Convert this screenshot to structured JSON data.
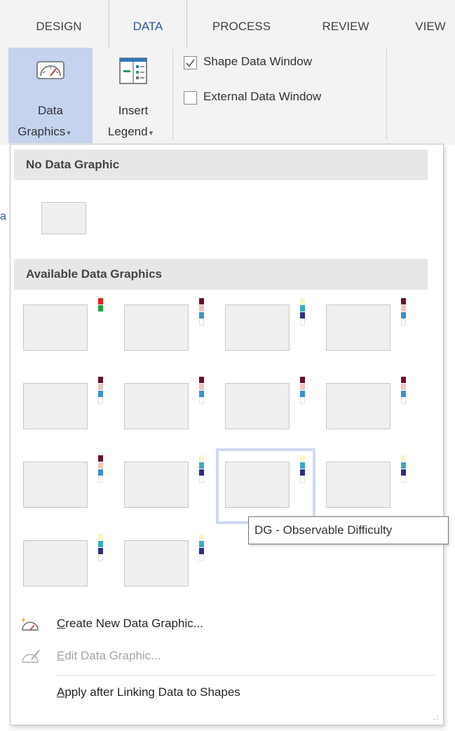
{
  "tabs": [
    {
      "label": "DESIGN"
    },
    {
      "label": "DATA"
    },
    {
      "label": "PROCESS"
    },
    {
      "label": "REVIEW"
    },
    {
      "label": "VIEW"
    }
  ],
  "ribbon": {
    "data_graphics": {
      "line1": "Data",
      "line2": "Graphics"
    },
    "insert_legend": {
      "line1": "Insert",
      "line2": "Legend"
    },
    "shape_data_window": {
      "label": "Shape Data Window",
      "checked": true
    },
    "external_data_window": {
      "label": "External Data Window",
      "checked": false
    }
  },
  "dropdown": {
    "no_data_graphic_header": "No Data Graphic",
    "available_header": "Available Data Graphics",
    "tooltip": "DG - Observable Difficulty",
    "menu": {
      "create_first": "C",
      "create_rest": "reate New Data Graphic...",
      "edit_first": "E",
      "edit_rest": "dit Data Graphic...",
      "apply_first": "A",
      "apply_rest": "pply after Linking Data to Shapes"
    }
  },
  "colors": {
    "accent": "#2b579a",
    "selected_button": "#c5d3ef",
    "highlight_border": "#cdd9f1",
    "dark_red": "#6a0f2a",
    "pink": "#efc6bd",
    "light_blue": "#3c92c8",
    "pale_yellow": "#f6f8c4",
    "teal": "#3da8bc",
    "navy": "#2a2f86",
    "red": "#e8201f",
    "green": "#23a33f"
  },
  "legend_palettes": {
    "rg": [
      "red",
      "green"
    ],
    "dpb": [
      "dark_red",
      "pink",
      "light_blue",
      "empty"
    ],
    "ytn": [
      "pale_yellow",
      "teal",
      "navy",
      "empty"
    ]
  },
  "graphics_grid": [
    [
      "rg",
      "dpb",
      "ytn",
      "dpb"
    ],
    [
      "dpb",
      "dpb",
      "dpb",
      "dpb"
    ],
    [
      "dpb",
      "ytn",
      "ytn",
      "ytn"
    ],
    [
      "ytn",
      "ytn"
    ]
  ],
  "selected_graphic": {
    "row": 2,
    "col": 2
  }
}
